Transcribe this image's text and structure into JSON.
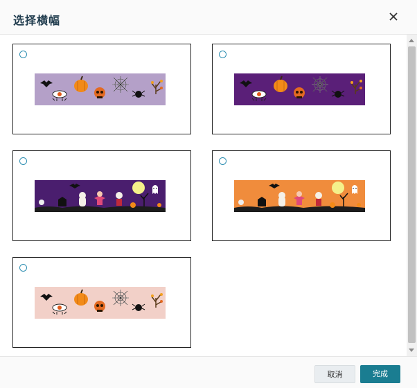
{
  "dialog": {
    "title": "选择横幅"
  },
  "banners": [
    {
      "id": "halloween-lavender",
      "background": "#b4a0c8",
      "style": "icons",
      "selected": false
    },
    {
      "id": "halloween-purple",
      "background": "#5a1f78",
      "style": "icons",
      "selected": false
    },
    {
      "id": "halloween-scene-purple",
      "background": "#4a1e6e",
      "style": "scene",
      "selected": false
    },
    {
      "id": "halloween-scene-orange",
      "background": "#f08c3c",
      "style": "scene",
      "selected": false
    },
    {
      "id": "halloween-pink",
      "background": "#f2d0c8",
      "style": "icons",
      "selected": false
    }
  ],
  "footer": {
    "cancel_label": "取消",
    "done_label": "完成"
  },
  "colors": {
    "accent": "#1a7d91",
    "radio": "#2f8fb2",
    "title": "#1f3b4d"
  }
}
